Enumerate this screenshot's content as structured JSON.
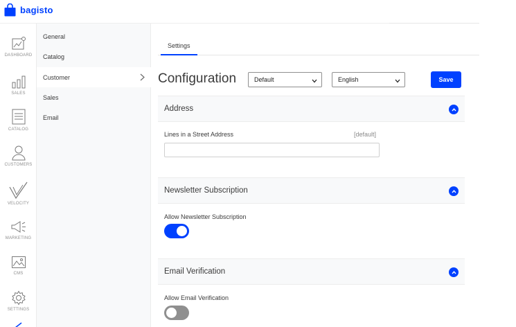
{
  "brand": {
    "name": "bagisto",
    "accent": "#0041ff"
  },
  "nav_rail": [
    {
      "label": "DASHBOARD",
      "icon": "dashboard-icon"
    },
    {
      "label": "SALES",
      "icon": "sales-bar-chart-icon"
    },
    {
      "label": "CATALOG",
      "icon": "catalog-list-icon"
    },
    {
      "label": "CUSTOMERS",
      "icon": "customers-person-icon"
    },
    {
      "label": "VELOCITY",
      "icon": "velocity-logo-icon"
    },
    {
      "label": "MARKETING",
      "icon": "marketing-megaphone-icon"
    },
    {
      "label": "CMS",
      "icon": "cms-image-icon"
    },
    {
      "label": "SETTINGS",
      "icon": "settings-gear-icon"
    }
  ],
  "submenu": {
    "items": [
      {
        "label": "General",
        "active": false
      },
      {
        "label": "Catalog",
        "active": false
      },
      {
        "label": "Customer",
        "active": true
      },
      {
        "label": "Sales",
        "active": false
      },
      {
        "label": "Email",
        "active": false
      }
    ]
  },
  "tabs": [
    {
      "label": "Settings",
      "active": true
    }
  ],
  "page": {
    "title": "Configuration",
    "channel_select": "Default",
    "locale_select": "English",
    "save_label": "Save"
  },
  "sections": [
    {
      "title": "Address",
      "expanded": true,
      "field_label": "Lines in a Street Address",
      "field_hint": "[default]",
      "field_value": ""
    },
    {
      "title": "Newsletter Subscription",
      "expanded": true,
      "field_label": "Allow Newsletter Subscription",
      "toggle_on": true
    },
    {
      "title": "Email Verification",
      "expanded": true,
      "field_label": "Allow Email Verification",
      "toggle_on": false
    }
  ]
}
